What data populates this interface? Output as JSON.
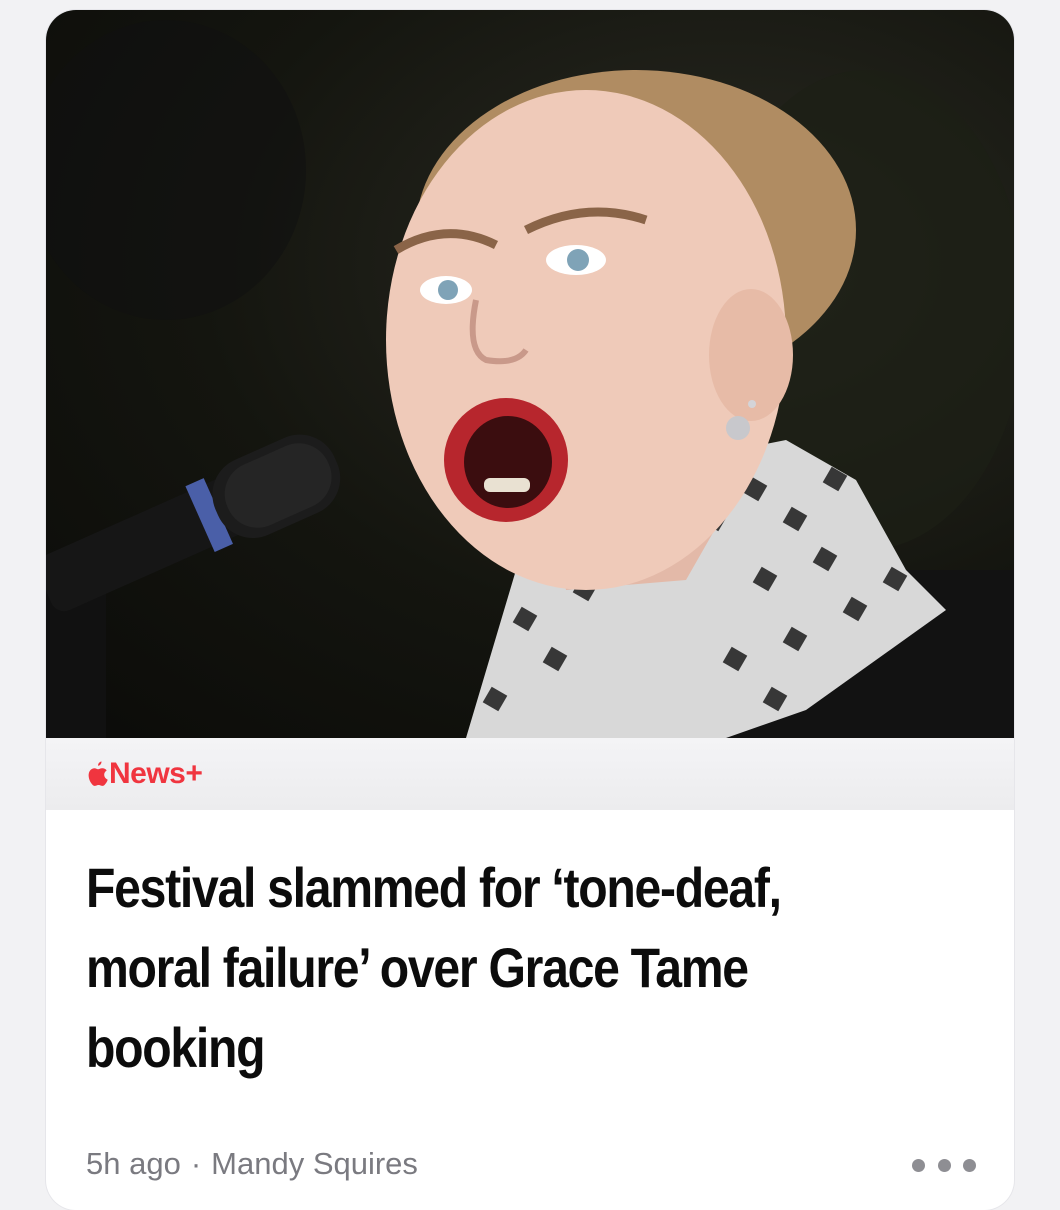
{
  "source": {
    "brand": "News+",
    "brand_color": "#f0353f"
  },
  "article": {
    "headline": "Festival slammed for ‘tone-deaf, moral failure’ over Grace Tame booking",
    "time_ago": "5h ago",
    "separator": "·",
    "author": "Mandy Squires"
  },
  "icons": {
    "brand": "apple-logo-icon",
    "more": "ellipsis-icon"
  }
}
